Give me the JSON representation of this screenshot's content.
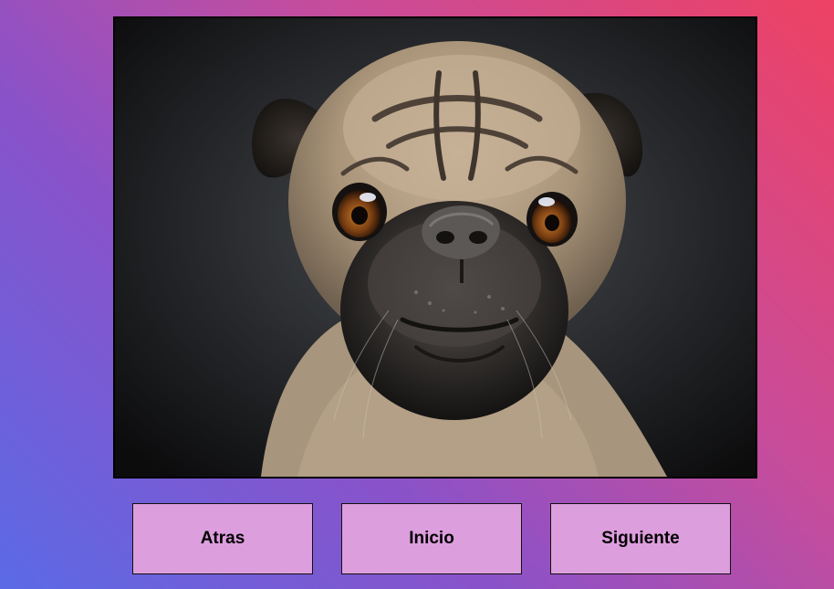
{
  "image": {
    "alt": "",
    "subject": "pug-photo"
  },
  "buttons": {
    "back_label": "Atras",
    "home_label": "Inicio",
    "next_label": "Siguiente"
  },
  "colors": {
    "button_bg": "#dd9ede",
    "gradient_start": "#5b6ae6",
    "gradient_end": "#ee4263"
  }
}
